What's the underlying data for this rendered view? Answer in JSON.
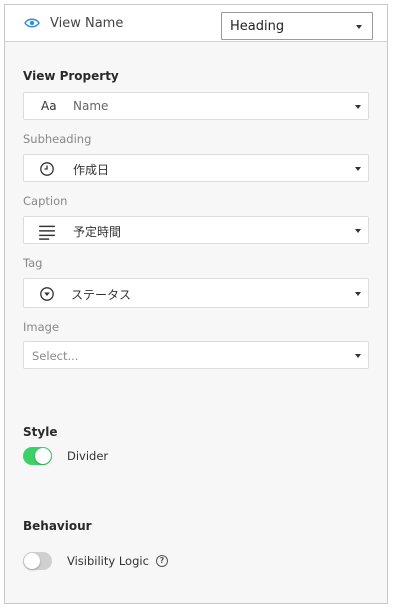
{
  "header": {
    "view_name_label": "View Name",
    "layout_select_value": "Heading",
    "icon": "eye-icon",
    "accent_color": "#2f8fd8"
  },
  "view_property": {
    "title": "View Property",
    "field": {
      "icon": "text-aa-icon",
      "icon_text": "Aa",
      "value": "Name"
    }
  },
  "subheading": {
    "label": "Subheading",
    "field": {
      "icon": "clock-icon",
      "value": "作成日"
    }
  },
  "caption": {
    "label": "Caption",
    "field": {
      "icon": "lines-icon",
      "value": "予定時間"
    }
  },
  "tag": {
    "label": "Tag",
    "field": {
      "icon": "dropdown-circle-icon",
      "value": "ステータス"
    }
  },
  "image": {
    "label": "Image",
    "field": {
      "placeholder": "Select..."
    }
  },
  "style": {
    "title": "Style",
    "divider_toggle": {
      "label": "Divider",
      "on": true,
      "color": "#3ecf6a"
    }
  },
  "behaviour": {
    "title": "Behaviour",
    "visibility_toggle": {
      "label": "Visibility Logic",
      "on": false,
      "help_icon": "question-circle-icon",
      "help_glyph": "?"
    }
  }
}
